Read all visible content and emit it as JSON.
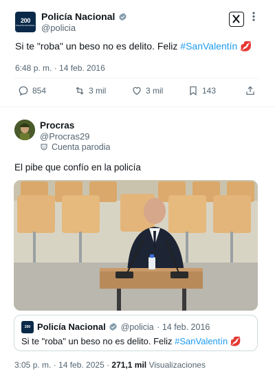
{
  "tweet": {
    "author_name": "Policía Nacional",
    "author_handle": "@policia",
    "avatar_text": "200",
    "avatar_subtext": "POLICÍA NACIONAL",
    "grok_label": "X",
    "more_label": "⋮",
    "text_before": "Si te \"roba\" un beso no es delito. Feliz ",
    "hashtag": "#SanValentín",
    "emoji": "💋",
    "timestamp": "6:48 p. m. · 14 feb. 2016",
    "replies": "854",
    "retweets": "3 mil",
    "likes": "3 mil",
    "bookmarks": "143"
  },
  "reply": {
    "author_name": "Procras",
    "author_handle": "@Procras29",
    "parody_label": "Cuenta parodia",
    "text": "El pibe que confío en la policía",
    "timestamp_prefix": "3:05 p. m. · 14 feb. 2025 · ",
    "views_count": "271,1 mil",
    "views_label": " Visualizaciones"
  },
  "quote": {
    "author_name": "Policía Nacional",
    "author_handle": "@policia",
    "date": "· 14 feb. 2016",
    "text_before": "Si te \"roba\" un beso no es delito. Feliz ",
    "hashtag": "#SanValentín",
    "emoji": "💋",
    "avatar_text": "200"
  },
  "colors": {
    "link": "#1d9bf0",
    "secondary_text": "#536471",
    "verified_badge": "#829aab",
    "divider": "#eff3f4"
  }
}
